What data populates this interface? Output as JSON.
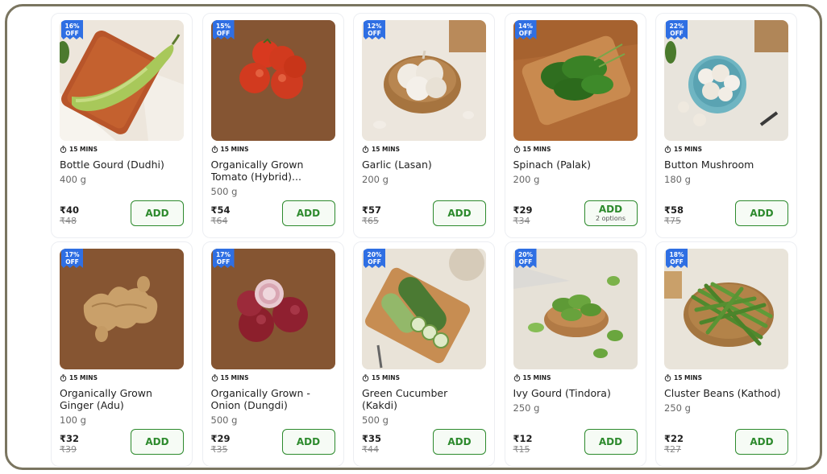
{
  "eta_icon": "stopwatch-icon",
  "colors": {
    "badge": "#2f6fe3",
    "add_border": "#2d8a2d",
    "add_bg": "#f6fbf5",
    "frame": "#7a7560"
  },
  "products": [
    {
      "key": "bottle-gourd",
      "discount_pct": "16%",
      "discount_off": "OFF",
      "eta": "15 MINS",
      "name": "Bottle Gourd (Dudhi)",
      "qty": "400 g",
      "price": "₹40",
      "mrp": "₹48",
      "add_label": "ADD",
      "options": ""
    },
    {
      "key": "tomato",
      "discount_pct": "15%",
      "discount_off": "OFF",
      "eta": "15 MINS",
      "name": "Organically Grown Tomato (Hybrid)...",
      "qty": "500 g",
      "price": "₹54",
      "mrp": "₹64",
      "add_label": "ADD",
      "options": ""
    },
    {
      "key": "garlic",
      "discount_pct": "12%",
      "discount_off": "OFF",
      "eta": "15 MINS",
      "name": "Garlic (Lasan)",
      "qty": "200 g",
      "price": "₹57",
      "mrp": "₹65",
      "add_label": "ADD",
      "options": ""
    },
    {
      "key": "spinach",
      "discount_pct": "14%",
      "discount_off": "OFF",
      "eta": "15 MINS",
      "name": "Spinach (Palak)",
      "qty": "200 g",
      "price": "₹29",
      "mrp": "₹34",
      "add_label": "ADD",
      "options": "2 options"
    },
    {
      "key": "mushroom",
      "discount_pct": "22%",
      "discount_off": "OFF",
      "eta": "15 MINS",
      "name": "Button Mushroom",
      "qty": "180 g",
      "price": "₹58",
      "mrp": "₹75",
      "add_label": "ADD",
      "options": ""
    },
    {
      "key": "ginger",
      "discount_pct": "17%",
      "discount_off": "OFF",
      "eta": "15 MINS",
      "name": "Organically Grown Ginger (Adu)",
      "qty": "100 g",
      "price": "₹32",
      "mrp": "₹39",
      "add_label": "ADD",
      "options": ""
    },
    {
      "key": "onion",
      "discount_pct": "17%",
      "discount_off": "OFF",
      "eta": "15 MINS",
      "name": "Organically Grown - Onion (Dungdi)",
      "qty": "500 g",
      "price": "₹29",
      "mrp": "₹35",
      "add_label": "ADD",
      "options": ""
    },
    {
      "key": "cucumber",
      "discount_pct": "20%",
      "discount_off": "OFF",
      "eta": "15 MINS",
      "name": "Green Cucumber (Kakdi)",
      "qty": "500 g",
      "price": "₹35",
      "mrp": "₹44",
      "add_label": "ADD",
      "options": ""
    },
    {
      "key": "ivy-gourd",
      "discount_pct": "20%",
      "discount_off": "OFF",
      "eta": "15 MINS",
      "name": "Ivy Gourd (Tindora)",
      "qty": "250 g",
      "price": "₹12",
      "mrp": "₹15",
      "add_label": "ADD",
      "options": ""
    },
    {
      "key": "cluster-beans",
      "discount_pct": "18%",
      "discount_off": "OFF",
      "eta": "15 MINS",
      "name": "Cluster Beans (Kathod)",
      "qty": "250 g",
      "price": "₹22",
      "mrp": "₹27",
      "add_label": "ADD",
      "options": ""
    }
  ]
}
